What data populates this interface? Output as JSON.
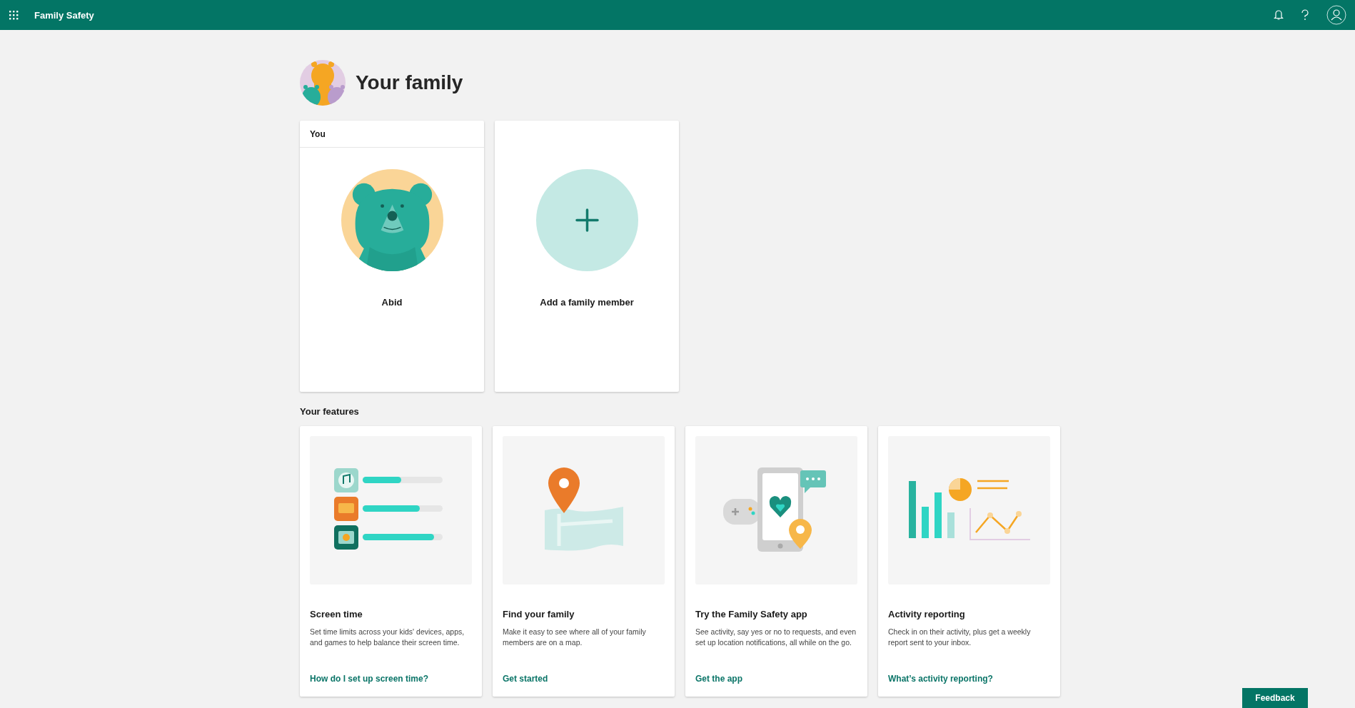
{
  "app_bar": {
    "title": "Family Safety"
  },
  "page": {
    "title": "Your family"
  },
  "members": [
    {
      "kind": "member",
      "section": "You",
      "name": "Abid"
    },
    {
      "kind": "add",
      "name": "Add a family member"
    }
  ],
  "features_title": "Your features",
  "features": [
    {
      "kind": "screen_time",
      "title": "Screen time",
      "description": "Set time limits across your kids' devices, apps, and games to help balance their screen time.",
      "link": "How do I set up screen time?"
    },
    {
      "kind": "map",
      "title": "Find your family",
      "description": "Make it easy to see where all of your family members are on a map.",
      "link": "Get started"
    },
    {
      "kind": "app",
      "title": "Try the Family Safety app",
      "description": "See activity, say yes or no to requests, and even set up location notifications, all while on the go.",
      "link": "Get the app"
    },
    {
      "kind": "reporting",
      "title": "Activity reporting",
      "description": "Check in on their activity, plus get a weekly report sent to your inbox.",
      "link": "What’s activity reporting?"
    }
  ],
  "feedback": "Feedback"
}
